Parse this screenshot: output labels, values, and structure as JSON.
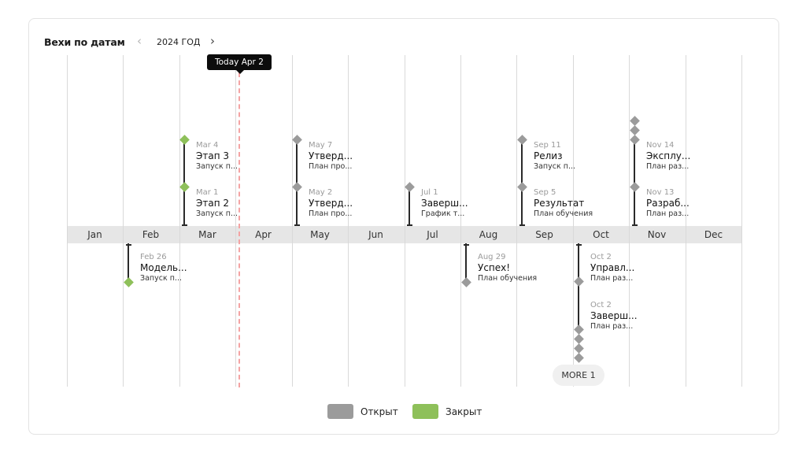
{
  "header": {
    "title": "Вехи по датам",
    "year": "2024 ГОД",
    "prev_icon": "chevron-left-icon",
    "next_icon": "chevron-right-icon"
  },
  "today": {
    "label": "Today Apr 2",
    "date": "2024-04-02",
    "color": "#f4a3a3"
  },
  "months": [
    "Jan",
    "Feb",
    "Mar",
    "Apr",
    "May",
    "Jun",
    "Jul",
    "Aug",
    "Sep",
    "Oct",
    "Nov",
    "Dec"
  ],
  "colors": {
    "open": "#9b9b9b",
    "closed": "#8ec05a",
    "band": "#e6e6e6"
  },
  "milestones": [
    {
      "date": "Mar 4",
      "name": "Этап 3",
      "sub": "Запуск п...",
      "status": "closed"
    },
    {
      "date": "Mar 1",
      "name": "Этап 2",
      "sub": "Запуск п...",
      "status": "closed"
    },
    {
      "date": "May 7",
      "name": "Утверд...",
      "sub": "План про...",
      "status": "open"
    },
    {
      "date": "May 2",
      "name": "Утверд...",
      "sub": "План про...",
      "status": "open"
    },
    {
      "date": "Jul 1",
      "name": "Заверш...",
      "sub": "График т...",
      "status": "open"
    },
    {
      "date": "Sep 11",
      "name": "Релиз",
      "sub": "Запуск п...",
      "status": "open"
    },
    {
      "date": "Sep 5",
      "name": "Результат",
      "sub": "План обучения",
      "status": "open"
    },
    {
      "date": "Nov 14",
      "name": "Эксплу...",
      "sub": "План раз...",
      "status": "open"
    },
    {
      "date": "Nov 13",
      "name": "Разраб...",
      "sub": "План раз...",
      "status": "open"
    },
    {
      "date": "Feb 26",
      "name": "Модель...",
      "sub": "Запуск п...",
      "status": "closed"
    },
    {
      "date": "Aug 29",
      "name": "Успех!",
      "sub": "План обучения",
      "status": "open"
    },
    {
      "date": "Oct 2",
      "name": "Управл...",
      "sub": "План раз...",
      "status": "open"
    },
    {
      "date": "Oct 2",
      "name": "Заверш...",
      "sub": "План раз...",
      "status": "open"
    }
  ],
  "more_button": "MORE 1",
  "legend": [
    {
      "label": "Открыт",
      "status": "open"
    },
    {
      "label": "Закрыт",
      "status": "closed"
    }
  ]
}
